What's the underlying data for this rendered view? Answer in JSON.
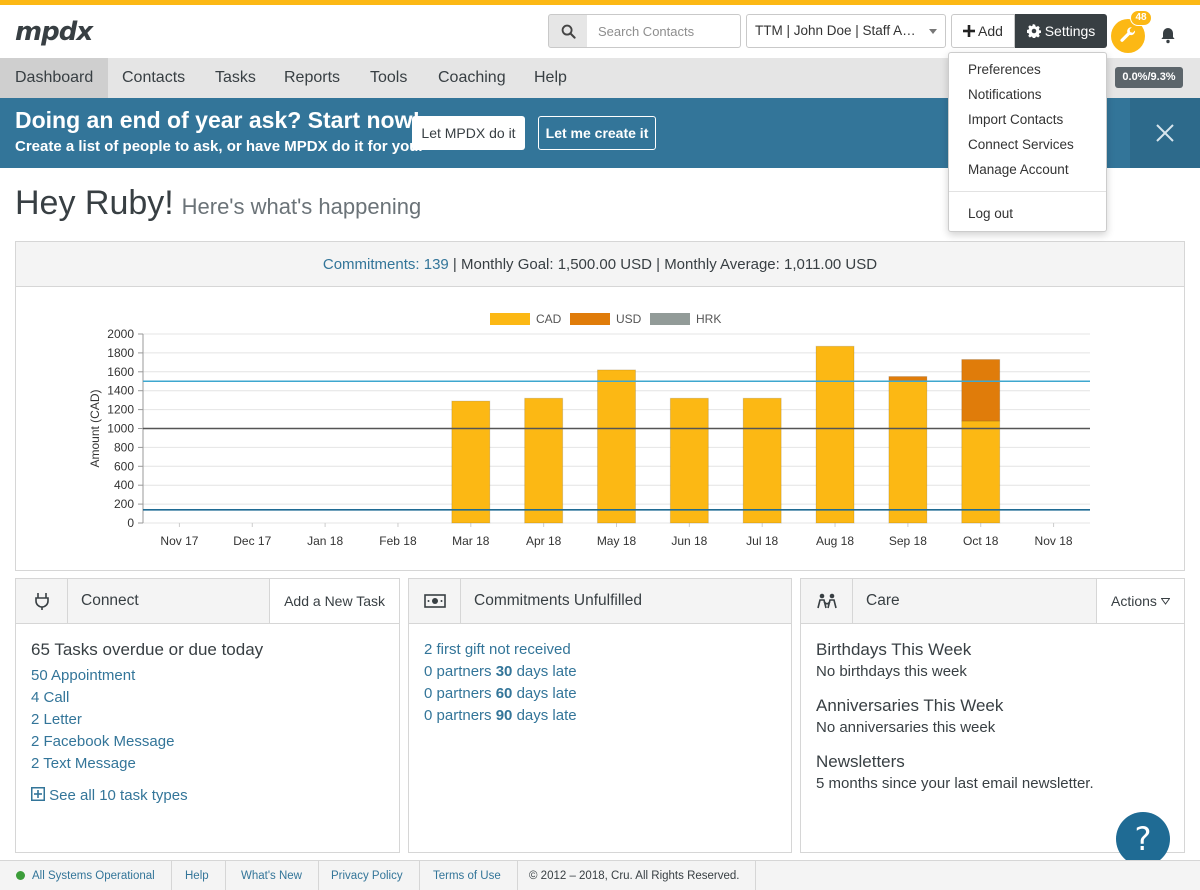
{
  "app": {
    "logo_text": "mpdx"
  },
  "header": {
    "search_placeholder": "Search Contacts",
    "account_label": "TTM | John Doe | Staff Account",
    "add_label": "Add",
    "settings_label": "Settings",
    "notification_count": "48"
  },
  "settings_menu": {
    "items": [
      "Preferences",
      "Notifications",
      "Import Contacts",
      "Connect Services",
      "Manage Account"
    ],
    "logout": "Log out"
  },
  "nav": {
    "items": [
      "Dashboard",
      "Contacts",
      "Tasks",
      "Reports",
      "Tools",
      "Coaching",
      "Help"
    ],
    "active": "Dashboard",
    "progress": "0.0%/9.3%"
  },
  "banner": {
    "title": "Doing an end of year ask? Start now!",
    "subtitle": "Create a list of people to ask, or have MPDX do it for you.",
    "btn_primary": "Let MPDX do it",
    "btn_secondary": "Let me create it"
  },
  "greeting": {
    "title": "Hey Ruby!",
    "subtitle": "Here's what's happening"
  },
  "chart_header": {
    "commitments_label": "Commitments: 139",
    "sep1": "|",
    "goal": "Monthly Goal: 1,500.00 USD",
    "sep2": "|",
    "average": "Monthly Average: 1,011.00 USD"
  },
  "chart_data": {
    "type": "bar",
    "stacked": true,
    "categories": [
      "Nov 17",
      "Dec 17",
      "Jan 18",
      "Feb 18",
      "Mar 18",
      "Apr 18",
      "May 18",
      "Jun 18",
      "Jul 18",
      "Aug 18",
      "Sep 18",
      "Oct 18",
      "Nov 18"
    ],
    "series": [
      {
        "name": "CAD",
        "color": "#fcb814",
        "values": [
          0,
          0,
          0,
          0,
          1290,
          1320,
          1620,
          1320,
          1320,
          1870,
          1500,
          1080,
          0
        ]
      },
      {
        "name": "USD",
        "color": "#e07c0a",
        "values": [
          0,
          0,
          0,
          0,
          0,
          0,
          0,
          0,
          0,
          0,
          50,
          650,
          0
        ]
      },
      {
        "name": "HRK",
        "color": "#929b98",
        "values": [
          0,
          0,
          0,
          0,
          0,
          0,
          0,
          0,
          0,
          0,
          0,
          0,
          0
        ]
      }
    ],
    "reference_lines": [
      {
        "value": 1500,
        "color": "#3ea7cf"
      },
      {
        "value": 1000,
        "color": "#555555"
      },
      {
        "value": 140,
        "color": "#1f6b94"
      }
    ],
    "ylabel": "Amount (CAD)",
    "xlabel": "",
    "ylim": [
      0,
      2000
    ],
    "yticks": [
      0,
      200,
      400,
      600,
      800,
      1000,
      1200,
      1400,
      1600,
      1800,
      2000
    ],
    "grid": true,
    "legend_position": "top-center"
  },
  "connect_card": {
    "title": "Connect",
    "action": "Add a New Task",
    "summary": "65 Tasks overdue or due today",
    "tasks": [
      "50 Appointment",
      "4 Call",
      "2 Letter",
      "2 Facebook Message",
      "2 Text Message"
    ],
    "see_all": "See all 10 task types"
  },
  "commitments_card": {
    "title": "Commitments Unfulfilled",
    "first_gift": "2 first gift not received",
    "late": [
      {
        "prefix": "0 partners ",
        "days": "30",
        "suffix": " days late"
      },
      {
        "prefix": "0 partners ",
        "days": "60",
        "suffix": " days late"
      },
      {
        "prefix": "0 partners ",
        "days": "90",
        "suffix": " days late"
      }
    ]
  },
  "care_card": {
    "title": "Care",
    "action": "Actions",
    "birthdays_title": "Birthdays This Week",
    "birthdays_text": "No birthdays this week",
    "anniversaries_title": "Anniversaries This Week",
    "anniversaries_text": "No anniversaries this week",
    "newsletters_title": "Newsletters",
    "newsletters_text": "5 months since your last email newsletter."
  },
  "help_button": "?",
  "footer": {
    "status": "All Systems Operational",
    "help": "Help",
    "whats_new": "What's New",
    "privacy": "Privacy Policy",
    "terms": "Terms of Use",
    "copyright": "© 2012 – 2018, Cru. All Rights Reserved."
  }
}
